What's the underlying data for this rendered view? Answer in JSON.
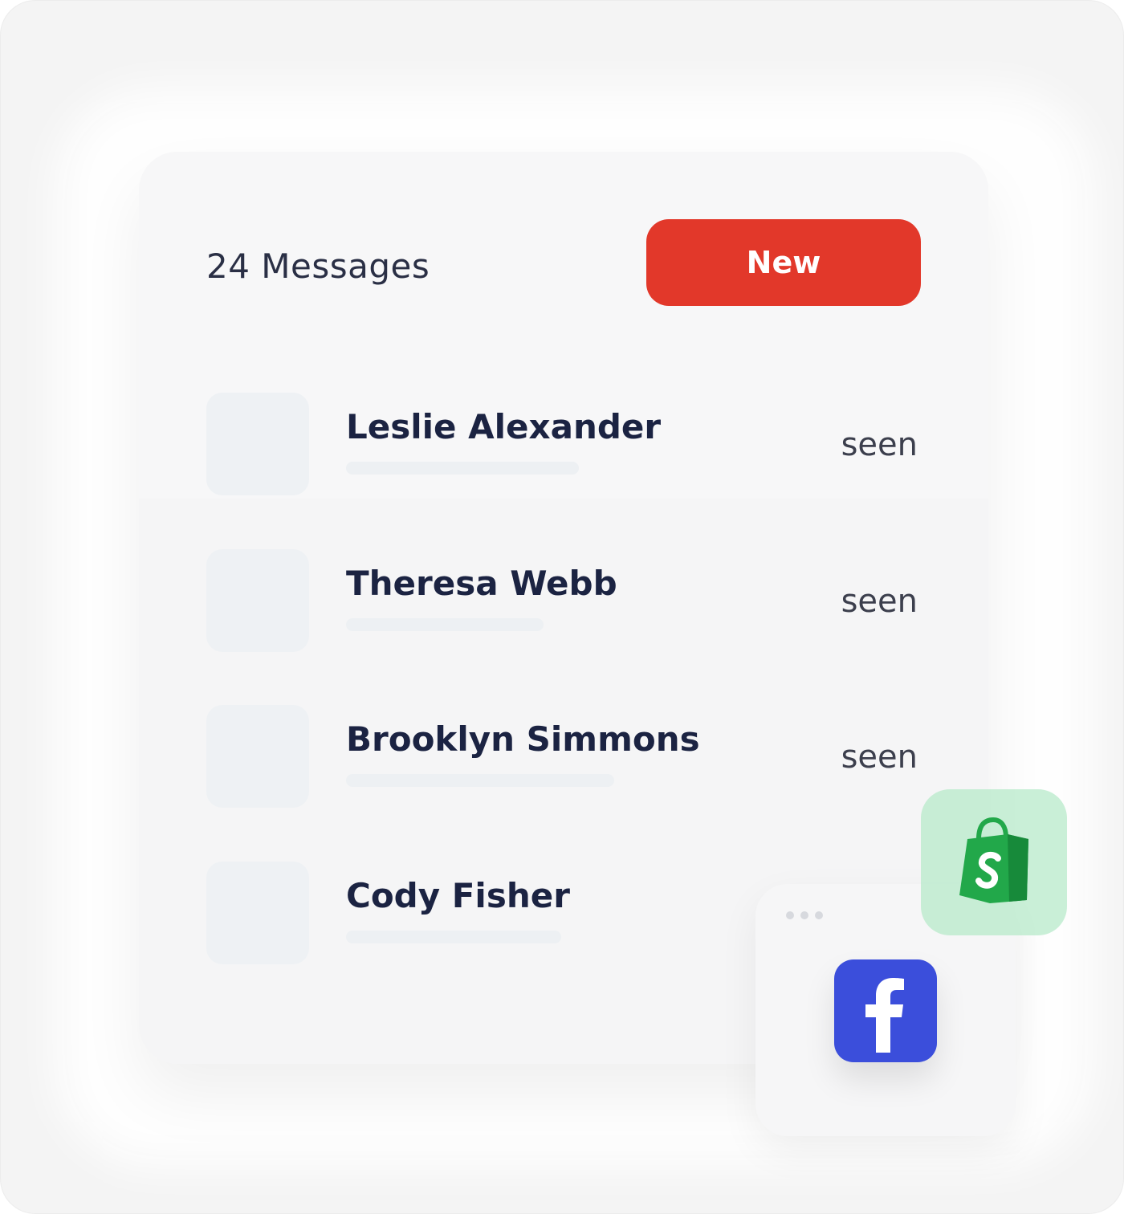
{
  "header": {
    "message_count": "24 Messages",
    "new_button_label": "New"
  },
  "messages": [
    {
      "name": "Leslie Alexander",
      "status": "seen"
    },
    {
      "name": "Theresa Webb",
      "status": "seen"
    },
    {
      "name": "Brooklyn Simmons",
      "status": "seen"
    },
    {
      "name": "Cody Fisher",
      "status": ""
    }
  ],
  "integrations": {
    "shopify_icon": "shopify-bag-icon",
    "facebook_icon": "facebook-f-icon"
  },
  "colors": {
    "new_button": "#e2382a",
    "facebook": "#3b4edb",
    "shopify_green": "#22a84a",
    "shopify_tile": "#bfeacd"
  }
}
